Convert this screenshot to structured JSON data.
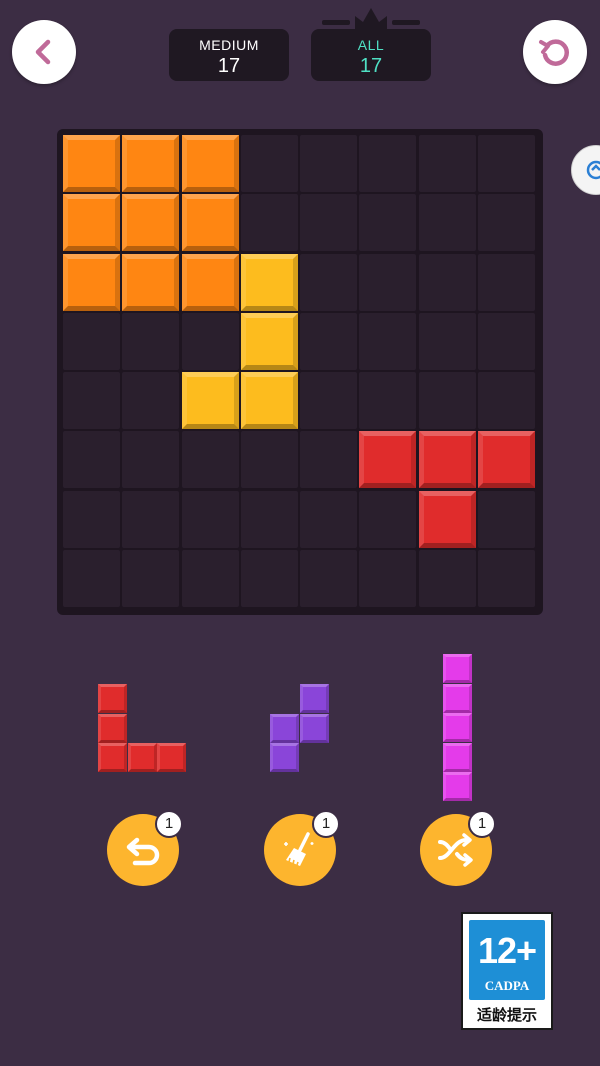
{
  "header": {
    "back_icon": "chevron-left-icon",
    "restart_icon": "restart-icon",
    "difficulty_label": "MEDIUM",
    "difficulty_value": "17",
    "all_label": "ALL",
    "all_value": "17",
    "crown_icon": "crown-icon"
  },
  "colors": {
    "background": "#3c2d44",
    "board": "#1e1520",
    "empty_cell": "#2a1f2d",
    "orange": "#ff8612",
    "yellow": "#fdbc1e",
    "red": "#e02c2c",
    "purple": "#8a45d9",
    "magenta": "#e43bea",
    "tool": "#fdb52e",
    "accent_teal": "#4fe0c4"
  },
  "board": {
    "rows": 8,
    "cols": 8,
    "filled": [
      {
        "r": 0,
        "c": 0,
        "color": "orange"
      },
      {
        "r": 0,
        "c": 1,
        "color": "orange"
      },
      {
        "r": 0,
        "c": 2,
        "color": "orange"
      },
      {
        "r": 1,
        "c": 0,
        "color": "orange"
      },
      {
        "r": 1,
        "c": 1,
        "color": "orange"
      },
      {
        "r": 1,
        "c": 2,
        "color": "orange"
      },
      {
        "r": 2,
        "c": 0,
        "color": "orange"
      },
      {
        "r": 2,
        "c": 1,
        "color": "orange"
      },
      {
        "r": 2,
        "c": 2,
        "color": "orange"
      },
      {
        "r": 2,
        "c": 3,
        "color": "yellow"
      },
      {
        "r": 3,
        "c": 3,
        "color": "yellow"
      },
      {
        "r": 4,
        "c": 2,
        "color": "yellow"
      },
      {
        "r": 4,
        "c": 3,
        "color": "yellow"
      },
      {
        "r": 5,
        "c": 5,
        "color": "red"
      },
      {
        "r": 5,
        "c": 6,
        "color": "red"
      },
      {
        "r": 5,
        "c": 7,
        "color": "red"
      },
      {
        "r": 6,
        "c": 6,
        "color": "red"
      }
    ]
  },
  "pieces": [
    {
      "name": "piece-l-red",
      "color": "red",
      "cells": [
        [
          0,
          0
        ],
        [
          1,
          0
        ],
        [
          2,
          0
        ],
        [
          2,
          1
        ],
        [
          2,
          2
        ]
      ]
    },
    {
      "name": "piece-s-purple",
      "color": "purple",
      "cells": [
        [
          0,
          1
        ],
        [
          1,
          0
        ],
        [
          1,
          1
        ],
        [
          2,
          0
        ]
      ]
    },
    {
      "name": "piece-i-magenta",
      "color": "magenta",
      "cells": [
        [
          0,
          0
        ],
        [
          1,
          0
        ],
        [
          2,
          0
        ],
        [
          3,
          0
        ],
        [
          4,
          0
        ]
      ]
    }
  ],
  "tools": [
    {
      "name": "undo",
      "icon": "undo-icon",
      "count": "1"
    },
    {
      "name": "clear",
      "icon": "broom-icon",
      "count": "1"
    },
    {
      "name": "shuffle",
      "icon": "shuffle-icon",
      "count": "1"
    }
  ],
  "rating": {
    "age": "12+",
    "org": "CADPA",
    "text": "适龄提示"
  }
}
